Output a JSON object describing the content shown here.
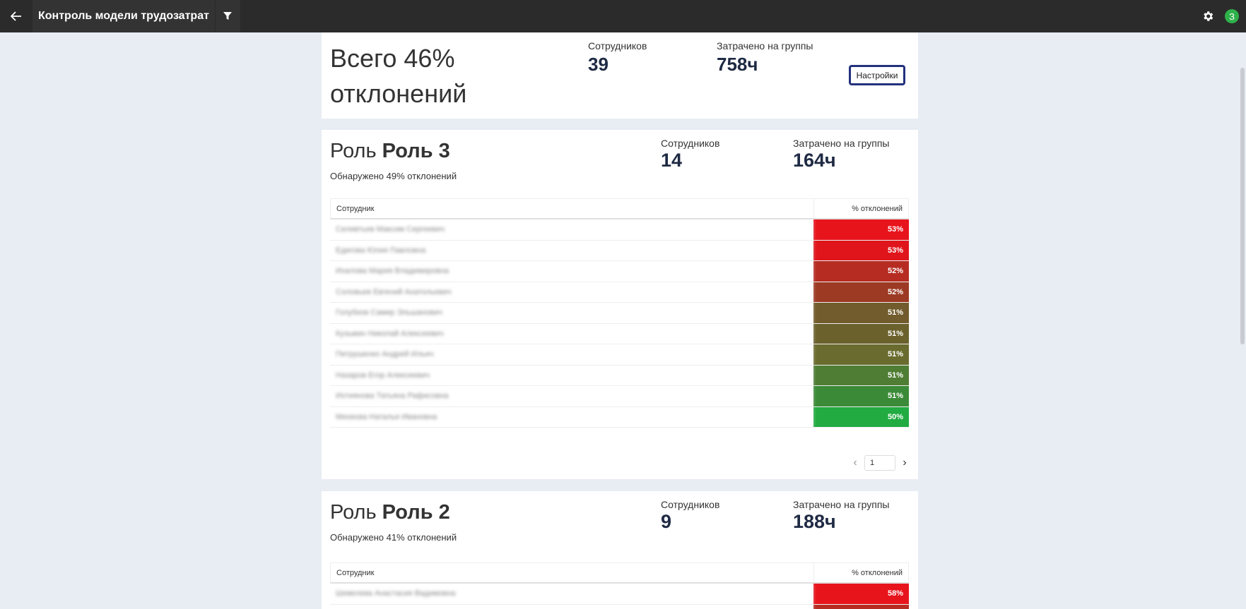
{
  "topbar": {
    "title": "Контроль модели трудозатрат",
    "back_icon": "arrow-left-icon",
    "filter_icon": "filter-icon",
    "settings_icon": "gear-icon",
    "avatar_letter": "З"
  },
  "summary": {
    "title": "Всего 46% отклонений",
    "employees_label": "Сотрудников",
    "employees_value": "39",
    "spent_label": "Затрачено на группы",
    "spent_value": "758ч",
    "settings_button": "Настройки"
  },
  "roles": [
    {
      "prefix": "Роль",
      "name": "Роль 3",
      "detected": "Обнаружено 49% отклонений",
      "employees_label": "Сотрудников",
      "employees_value": "14",
      "spent_label": "Затрачено на группы",
      "spent_value": "164ч",
      "col_employee": "Сотрудник",
      "col_pct": "% отклонений",
      "rows": [
        {
          "name": "Селивтьев Максим Сергеевич",
          "pct": "53%",
          "color": "#e8141c"
        },
        {
          "name": "Едигова Юлия Павловна",
          "pct": "53%",
          "color": "#e0151c"
        },
        {
          "name": "Ихалова Мария Владимировна",
          "pct": "52%",
          "color": "#b62c22"
        },
        {
          "name": "Соловьев Евгений Анатольевич",
          "pct": "52%",
          "color": "#9c3a24"
        },
        {
          "name": "Голубков Самир Эльшанович",
          "pct": "51%",
          "color": "#725b2c"
        },
        {
          "name": "Кузьмин Николай Алексеевич",
          "pct": "51%",
          "color": "#6b612d"
        },
        {
          "name": "Петрушенко Андрей Ильич",
          "pct": "51%",
          "color": "#6a6c2f"
        },
        {
          "name": "Назаров Егор Алексеевич",
          "pct": "51%",
          "color": "#4f7d33"
        },
        {
          "name": "Ихтиянова Татьяна Рафисовна",
          "pct": "51%",
          "color": "#3b8a37"
        },
        {
          "name": "Михеєва Наталья Ивановна",
          "pct": "50%",
          "color": "#21ab41"
        }
      ],
      "page": "1"
    },
    {
      "prefix": "Роль",
      "name": "Роль 2",
      "detected": "Обнаружено 41% отклонений",
      "employees_label": "Сотрудников",
      "employees_value": "9",
      "spent_label": "Затрачено на группы",
      "spent_value": "188ч",
      "col_employee": "Сотрудник",
      "col_pct": "% отклонений",
      "rows": [
        {
          "name": "Шевелева Анастасия Вадимовна",
          "pct": "58%",
          "color": "#e8141c"
        },
        {
          "name": "",
          "pct": "",
          "color": "#b62c22"
        }
      ]
    }
  ]
}
